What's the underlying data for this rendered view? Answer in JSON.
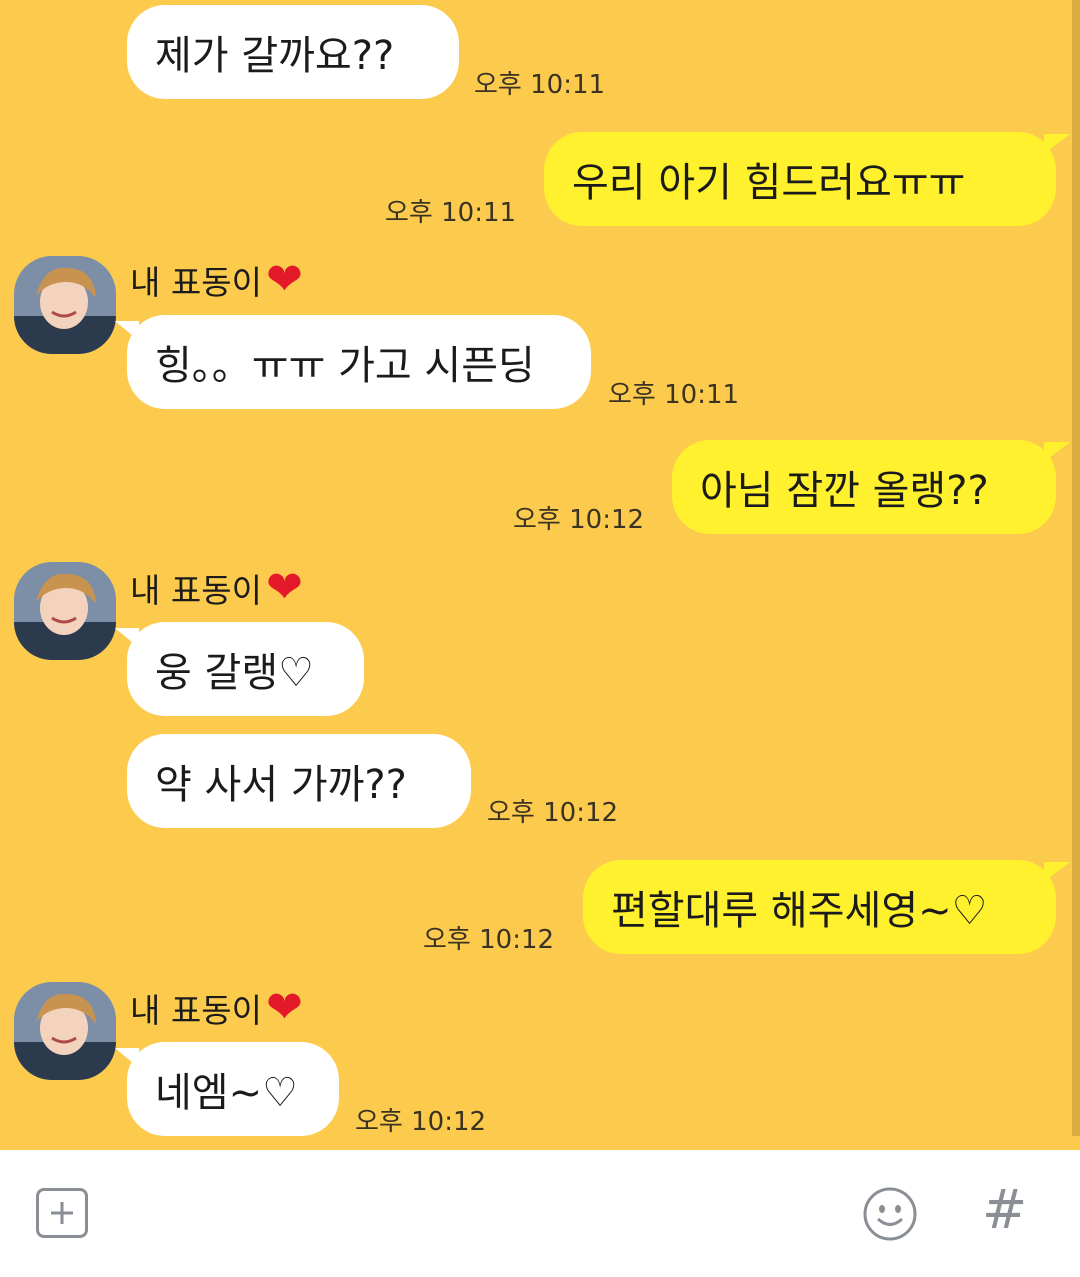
{
  "colors": {
    "background": "#fccb4e",
    "incoming_bubble": "#ffffff",
    "outgoing_bubble": "#fff12e",
    "heart": "#e3192a",
    "input_bar": "#ffffff",
    "icon_gray": "#8a8f96"
  },
  "sender_name": "내 표동이",
  "sender_heart": "❤",
  "messages": [
    {
      "direction": "in",
      "text": "제가 갈까요??",
      "time": "오후 10:11"
    },
    {
      "direction": "out",
      "text": "우리 아기 힘드러요ㅠㅠ",
      "time": "오후 10:11"
    },
    {
      "direction": "in",
      "text": "힝。。ㅠㅠ 가고 시픈딩",
      "time": "오후 10:11",
      "show_sender": true
    },
    {
      "direction": "out",
      "text": "아님 잠깐 올랭??",
      "time": "오후 10:12"
    },
    {
      "direction": "in",
      "text": "웅 갈랭♡",
      "time": "",
      "show_sender": true
    },
    {
      "direction": "in",
      "text": "약 사서 가까??",
      "time": "오후 10:12"
    },
    {
      "direction": "out",
      "text": "편할대루 해주세영~♡",
      "time": "오후 10:12"
    },
    {
      "direction": "in",
      "text": "네엠~♡",
      "time": "오후 10:12",
      "show_sender": true
    }
  ],
  "input_bar": {
    "left_icon": "plus-square-icon",
    "emoji_icon": "smiley-icon",
    "hash_label": "#"
  }
}
